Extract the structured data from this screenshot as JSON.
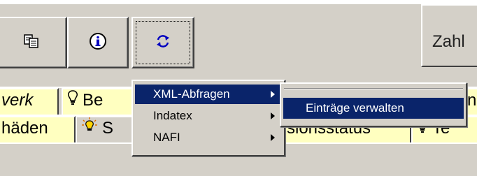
{
  "toolbar": {
    "buttons": [
      {
        "icon": "copy-icon"
      },
      {
        "icon": "info-icon"
      },
      {
        "icon": "refresh-icon"
      }
    ],
    "zahl_label": "Zahl"
  },
  "tabs_row1": [
    {
      "label": "verk",
      "icon": "lightbulb-icon"
    },
    {
      "label": "Be",
      "icon": "lightbulb-icon"
    },
    {
      "label": "n",
      "icon": ""
    }
  ],
  "tabs_row2": [
    {
      "label": "häden",
      "icon": ""
    },
    {
      "label": "S",
      "icon": "lightbulb-on-icon"
    },
    {
      "label": "sionsstatus",
      "icon": ""
    },
    {
      "label": "Te",
      "icon": "lightbulb-icon"
    }
  ],
  "context_menu": {
    "items": [
      {
        "label": "XML-Abfragen",
        "has_submenu": true,
        "selected": true
      },
      {
        "label": "Indatex",
        "has_submenu": true,
        "selected": false
      },
      {
        "label": "NAFI",
        "has_submenu": true,
        "selected": false
      }
    ]
  },
  "submenu": {
    "items": [
      {
        "label": "Einträge verwalten",
        "selected": true
      }
    ]
  },
  "colors": {
    "face": "#d4d0c8",
    "tab_yellow": "#ffffc0",
    "highlight": "#0a246a"
  }
}
